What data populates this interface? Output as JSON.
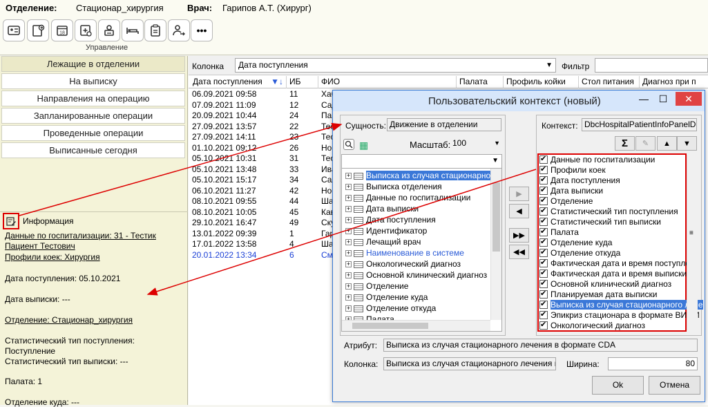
{
  "header": {
    "dept_label": "Отделение:",
    "dept_value": "Стационар_хирургия",
    "doctor_label": "Врач:",
    "doctor_value": "Гарипов А.Т. (Хирург)",
    "toolbar_caption": "Управление",
    "toolbar_icons": [
      "id-card-icon",
      "transfer-doc-icon",
      "calendar-18-icon",
      "medkit-icon",
      "patient-print-icon",
      "bed-transfer-icon",
      "clipboard-icon",
      "person-out-icon",
      "more-icon"
    ],
    "calendar_day": "18",
    "more_label": "•••"
  },
  "sidebar": {
    "items": [
      {
        "label": "Лежащие в отделении"
      },
      {
        "label": "На выписку"
      },
      {
        "label": "Направления на операцию"
      },
      {
        "label": "Запланированные операции"
      },
      {
        "label": "Проведенные операции"
      },
      {
        "label": "Выписанные сегодня"
      }
    ]
  },
  "info": {
    "title": "Информация",
    "hosp1": "Данные по госпитализации: 31 - Тестик",
    "hosp2": "Пациент Тестович",
    "beds": "Профили коек: Хирургия",
    "admission": "Дата поступления: 05.10.2021",
    "discharge": "Дата выписки: ---",
    "department": "Отделение: Стационар_хирургия",
    "stat_in_1": "Статистический тип поступления:",
    "stat_in_2": "Поступление",
    "stat_out": "Статистический тип выписки: ---",
    "ward": "Палата: 1",
    "dept_where": "Отделение куда: ---"
  },
  "grid": {
    "column_label": "Колонка",
    "column_value": "Дата поступления",
    "filter_label": "Фильтр",
    "headers": [
      "Дата поступления",
      "ИБ",
      "ФИО",
      "Палата",
      "Профиль койки",
      "Стол питания",
      "Диагноз при п"
    ],
    "rows": [
      {
        "date": "06.09.2021 09:58",
        "ib": "11",
        "fio": "Хаб"
      },
      {
        "date": "07.09.2021 11:09",
        "ib": "12",
        "fio": "Сад"
      },
      {
        "date": "20.09.2021 10:44",
        "ib": "24",
        "fio": "Пав"
      },
      {
        "date": "27.09.2021 13:57",
        "ib": "22",
        "fio": "Тес"
      },
      {
        "date": "27.09.2021 14:11",
        "ib": "23",
        "fio": "Тес"
      },
      {
        "date": "01.10.2021 09:12",
        "ib": "26",
        "fio": "Нов"
      },
      {
        "date": "05.10.2021 10:31",
        "ib": "31",
        "fio": "Тес"
      },
      {
        "date": "05.10.2021 13:48",
        "ib": "33",
        "fio": "Ива"
      },
      {
        "date": "05.10.2021 15:17",
        "ib": "34",
        "fio": "Сал"
      },
      {
        "date": "06.10.2021 11:27",
        "ib": "42",
        "fio": "Нос"
      },
      {
        "date": "08.10.2021 09:55",
        "ib": "44",
        "fio": "Шаг"
      },
      {
        "date": "08.10.2021 10:05",
        "ib": "45",
        "fio": "Кав"
      },
      {
        "date": "29.10.2021 16:47",
        "ib": "49",
        "fio": "Ску"
      },
      {
        "date": "13.01.2022 09:39",
        "ib": "1",
        "fio": "Гар"
      },
      {
        "date": "17.01.2022 13:58",
        "ib": "4",
        "fio": "Шаг"
      },
      {
        "date": "20.01.2022 13:34",
        "ib": "6",
        "fio": "Смо"
      }
    ]
  },
  "dialog": {
    "title": "Пользовательский контекст (новый)",
    "entity_label": "Сущность:",
    "entity_value": "Движение в отделении",
    "scale_label": "Масштаб:",
    "scale_value": "100",
    "context_label": "Контекст:",
    "context_value": "DbcHospitalPatientInfoPanelDivisi",
    "tree": [
      "Выписка из случая стационарного",
      "Выписка отделения",
      "Данные по госпитализации",
      "Дата выписки",
      "Дата поступления",
      "Идентификатор",
      "Лечащий врач",
      "Наименование в системе",
      "Онкологический диагноз",
      "Основной клинический диагноз",
      "Отделение",
      "Отделение куда",
      "Отделение откуда",
      "Палата"
    ],
    "checked": [
      "Данные по госпитализации",
      "Профили коек",
      "Дата поступления",
      "Дата выписки",
      "Отделение",
      "Статистический тип поступления",
      "Статистический тип выписки",
      "Палата",
      "Отделение куда",
      "Отделение откуда",
      "Фактическая дата и время поступлен",
      "Фактическая дата и время выписки",
      "Основной клинический диагноз",
      "Планируемая дата выписки",
      "Выписка из случая стационарного лече",
      "Эпикриз стационара в формате ВИМИ",
      "Онкологический диагноз"
    ],
    "attribute_label": "Атрибут:",
    "attribute_value": "Выписка из случая стационарного лечения в формате CDA",
    "column_label": "Колонка:",
    "column_value": "Выписка из случая стационарного лечения в фор",
    "width_label": "Ширина:",
    "width_value": "80",
    "ok_label": "Ok",
    "cancel_label": "Отмена",
    "move_right": "▶",
    "move_left": "◀",
    "move_all_right": "▶▶",
    "move_all_left": "◀◀",
    "sum_symbol": "Σ",
    "up_arrow": "▲",
    "down_arrow": "▼"
  },
  "colors": {
    "accent": "#3b78d8",
    "annotation": "#d00000"
  }
}
